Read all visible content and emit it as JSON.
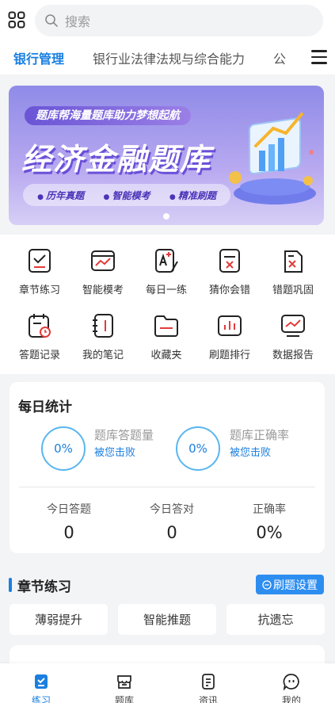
{
  "search": {
    "placeholder": "搜索"
  },
  "tabs": [
    "银行管理",
    "银行业法律法规与综合能力",
    "公"
  ],
  "banner": {
    "tagline": "题库帮海量题库助力梦想起航",
    "title": "经济金融题库",
    "chips": [
      "历年真题",
      "智能模考",
      "精准刷题"
    ]
  },
  "features": [
    {
      "label": "章节练习",
      "icon": "chapter-practice-icon"
    },
    {
      "label": "智能模考",
      "icon": "smart-mock-icon"
    },
    {
      "label": "每日一练",
      "icon": "daily-practice-icon"
    },
    {
      "label": "猜你会错",
      "icon": "guess-wrong-icon"
    },
    {
      "label": "错题巩固",
      "icon": "wrong-review-icon"
    },
    {
      "label": "答题记录",
      "icon": "answer-record-icon"
    },
    {
      "label": "我的笔记",
      "icon": "notes-icon"
    },
    {
      "label": "收藏夹",
      "icon": "favorites-folder-icon"
    },
    {
      "label": "刷题排行",
      "icon": "ranking-icon"
    },
    {
      "label": "数据报告",
      "icon": "data-report-icon"
    }
  ],
  "daily": {
    "title": "每日统计",
    "volume": {
      "percent": "0%",
      "label": "题库答题量",
      "sub": "被您击败"
    },
    "accuracy": {
      "percent": "0%",
      "label": "题库正确率",
      "sub": "被您击败"
    },
    "stats": [
      {
        "label": "今日答题",
        "value": "0"
      },
      {
        "label": "今日答对",
        "value": "0"
      },
      {
        "label": "正确率",
        "value": "0%"
      }
    ]
  },
  "chapter": {
    "title": "章节练习",
    "settings_label": "刷题设置",
    "pills": [
      "薄弱提升",
      "智能推题",
      "抗遗忘"
    ]
  },
  "nav": [
    {
      "label": "练习",
      "active": true
    },
    {
      "label": "题库",
      "active": false
    },
    {
      "label": "资讯",
      "active": false
    },
    {
      "label": "我的",
      "active": false
    }
  ],
  "colors": {
    "accent": "#1a7fe0",
    "ring": "#59b6ef",
    "settings_button": "#2e8ef0"
  }
}
